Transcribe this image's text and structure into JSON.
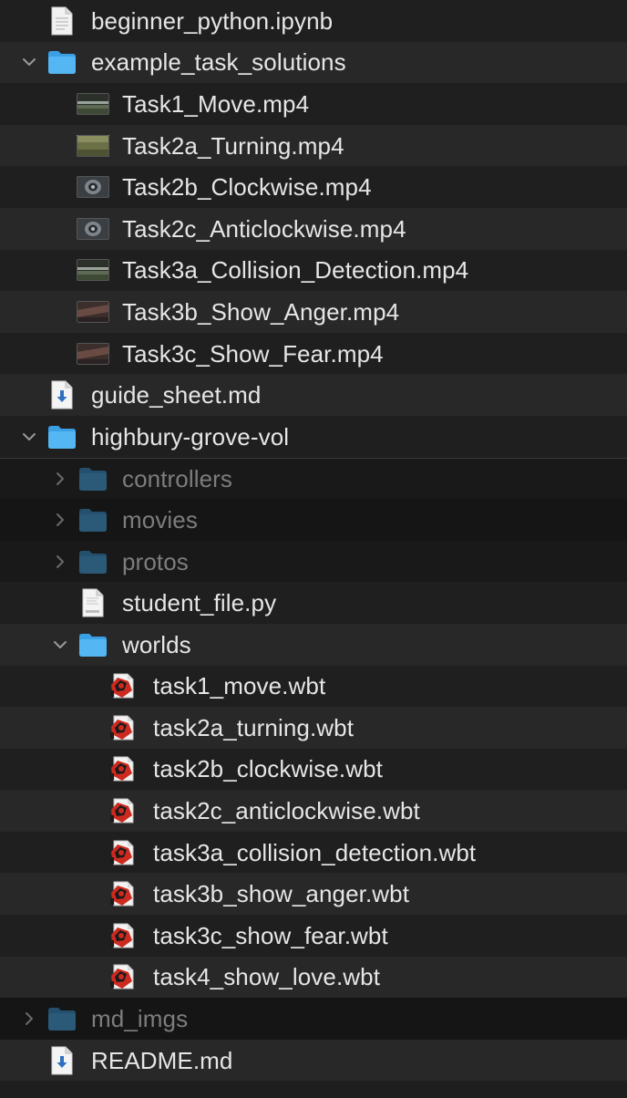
{
  "tree": [
    {
      "label": "beginner_python.ipynb",
      "icon": "document-icon",
      "depth": 0,
      "chevron": "none",
      "dim": false
    },
    {
      "label": "example_task_solutions",
      "icon": "folder-icon",
      "depth": 0,
      "chevron": "expanded",
      "dim": false
    },
    {
      "label": "Task1_Move.mp4",
      "icon": "video-thumbnail-icon",
      "depth": 1,
      "chevron": "none",
      "dim": false,
      "thumb": "move"
    },
    {
      "label": "Task2a_Turning.mp4",
      "icon": "video-thumbnail-icon",
      "depth": 1,
      "chevron": "none",
      "dim": false,
      "thumb": "turning"
    },
    {
      "label": "Task2b_Clockwise.mp4",
      "icon": "video-thumbnail-icon",
      "depth": 1,
      "chevron": "none",
      "dim": false,
      "thumb": "robot"
    },
    {
      "label": "Task2c_Anticlockwise.mp4",
      "icon": "video-thumbnail-icon",
      "depth": 1,
      "chevron": "none",
      "dim": false,
      "thumb": "robot"
    },
    {
      "label": "Task3a_Collision_Detection.mp4",
      "icon": "video-thumbnail-icon",
      "depth": 1,
      "chevron": "none",
      "dim": false,
      "thumb": "move"
    },
    {
      "label": "Task3b_Show_Anger.mp4",
      "icon": "video-thumbnail-icon",
      "depth": 1,
      "chevron": "none",
      "dim": false,
      "thumb": "warm"
    },
    {
      "label": "Task3c_Show_Fear.mp4",
      "icon": "video-thumbnail-icon",
      "depth": 1,
      "chevron": "none",
      "dim": false,
      "thumb": "warm"
    },
    {
      "label": "guide_sheet.md",
      "icon": "markdown-file-icon",
      "depth": 0,
      "chevron": "none",
      "dim": false
    },
    {
      "label": "highbury-grove-vol",
      "icon": "folder-icon",
      "depth": 0,
      "chevron": "expanded",
      "dim": false
    },
    {
      "label": "controllers",
      "icon": "folder-icon",
      "depth": 1,
      "chevron": "collapsed",
      "dim": true
    },
    {
      "label": "movies",
      "icon": "folder-icon",
      "depth": 1,
      "chevron": "collapsed",
      "dim": true
    },
    {
      "label": "protos",
      "icon": "folder-icon",
      "depth": 1,
      "chevron": "collapsed",
      "dim": true
    },
    {
      "label": "student_file.py",
      "icon": "python-file-icon",
      "depth": 1,
      "chevron": "none",
      "dim": false
    },
    {
      "label": "worlds",
      "icon": "folder-icon",
      "depth": 1,
      "chevron": "expanded",
      "dim": false
    },
    {
      "label": "task1_move.wbt",
      "icon": "webots-world-icon",
      "depth": 2,
      "chevron": "none",
      "dim": false
    },
    {
      "label": "task2a_turning.wbt",
      "icon": "webots-world-icon",
      "depth": 2,
      "chevron": "none",
      "dim": false
    },
    {
      "label": "task2b_clockwise.wbt",
      "icon": "webots-world-icon",
      "depth": 2,
      "chevron": "none",
      "dim": false
    },
    {
      "label": "task2c_anticlockwise.wbt",
      "icon": "webots-world-icon",
      "depth": 2,
      "chevron": "none",
      "dim": false
    },
    {
      "label": "task3a_collision_detection.wbt",
      "icon": "webots-world-icon",
      "depth": 2,
      "chevron": "none",
      "dim": false
    },
    {
      "label": "task3b_show_anger.wbt",
      "icon": "webots-world-icon",
      "depth": 2,
      "chevron": "none",
      "dim": false
    },
    {
      "label": "task3c_show_fear.wbt",
      "icon": "webots-world-icon",
      "depth": 2,
      "chevron": "none",
      "dim": false
    },
    {
      "label": "task4_show_love.wbt",
      "icon": "webots-world-icon",
      "depth": 2,
      "chevron": "none",
      "dim": false
    },
    {
      "label": "md_imgs",
      "icon": "folder-icon",
      "depth": 0,
      "chevron": "collapsed",
      "dim": true
    },
    {
      "label": "README.md",
      "icon": "markdown-file-icon",
      "depth": 0,
      "chevron": "none",
      "dim": false
    }
  ],
  "colors": {
    "folder": "#54b6f2",
    "folder_dim": "#2b5a78",
    "text": "#e6e6e6",
    "text_dim": "#7d7d7d",
    "row_alt": "#282828",
    "background": "#1f1f1f"
  }
}
